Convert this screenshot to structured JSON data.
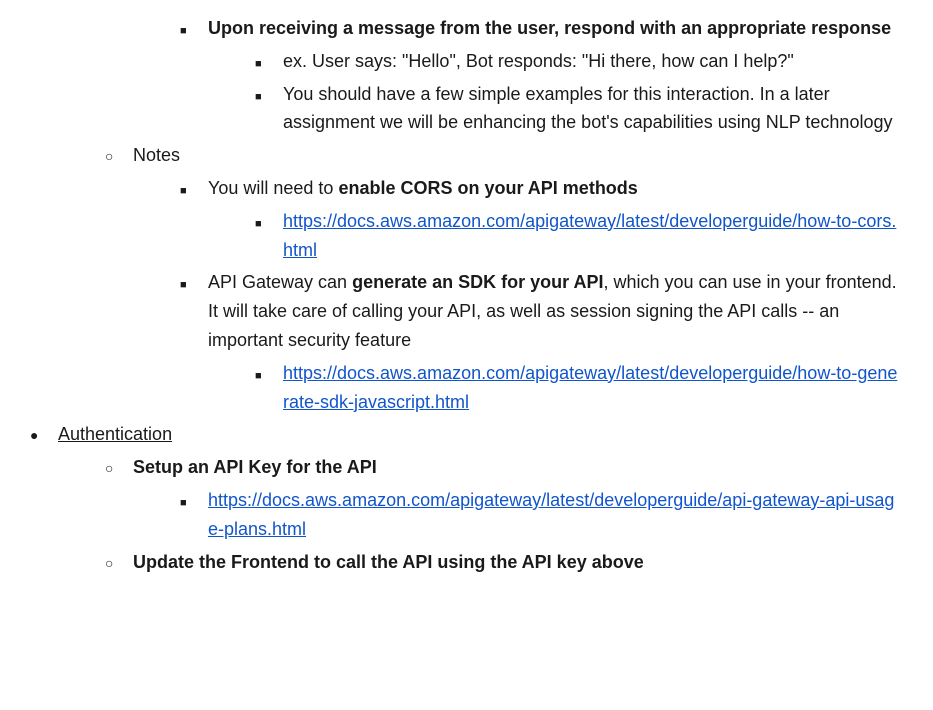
{
  "items": {
    "respond_heading": "Upon receiving a message from the user, respond with an appropriate response",
    "example_hello": "ex. User says: \"Hello\", Bot responds: \"Hi there, how can I help?\"",
    "simple_examples": "You should have a few simple examples for this interaction. In a later assignment we will be enhancing the bot's capabilities using NLP technology",
    "notes": "Notes",
    "enable_cors_pre": "You will need to ",
    "enable_cors_bold": "enable CORS on your API methods",
    "cors_link": "https://docs.aws.amazon.com/apigateway/latest/developerguide/how-to-cors.html",
    "generate_sdk_pre": "API Gateway can ",
    "generate_sdk_bold": "generate an SDK for your API",
    "generate_sdk_post": ", which you can use in your frontend. It will take care of calling your API, as well as session signing the API calls -- an important security feature",
    "sdk_link": "https://docs.aws.amazon.com/apigateway/latest/developerguide/how-to-generate-sdk-javascript.html",
    "authentication": "Authentication",
    "setup_api_key": "Setup an API Key for the API",
    "api_key_link": "https://docs.aws.amazon.com/apigateway/latest/developerguide/api-gateway-api-usage-plans.html",
    "update_frontend": "Update the Frontend to call the API using the API key above"
  }
}
